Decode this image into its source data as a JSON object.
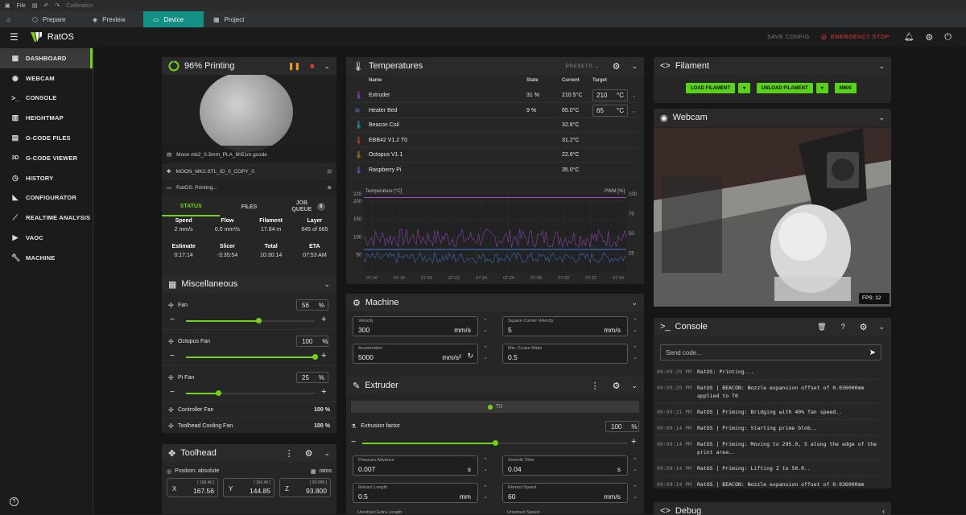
{
  "titlebar": {
    "file": "File",
    "title": "Calibration"
  },
  "tabs": [
    {
      "label": "Prepare",
      "icon": "prepare-icon"
    },
    {
      "label": "Preview",
      "icon": "preview-icon"
    },
    {
      "label": "Device",
      "icon": "device-icon"
    },
    {
      "label": "Project",
      "icon": "project-icon"
    }
  ],
  "app": {
    "name": "RatOS",
    "save_config": "SAVE CONFIG",
    "emergency_stop": "EMERGENCY STOP"
  },
  "sidebar": [
    {
      "label": "DASHBOARD",
      "icon": "dashboard-icon"
    },
    {
      "label": "WEBCAM",
      "icon": "webcam-icon"
    },
    {
      "label": "CONSOLE",
      "icon": "console-icon"
    },
    {
      "label": "HEIGHTMAP",
      "icon": "heightmap-icon"
    },
    {
      "label": "G-CODE FILES",
      "icon": "files-icon"
    },
    {
      "label": "G-CODE VIEWER",
      "icon": "viewer-icon"
    },
    {
      "label": "HISTORY",
      "icon": "history-icon"
    },
    {
      "label": "CONFIGURATOR",
      "icon": "configurator-icon"
    },
    {
      "label": "REALTIME ANALYSIS",
      "icon": "analysis-icon"
    },
    {
      "label": "VAOC",
      "icon": "vaoc-icon"
    },
    {
      "label": "MACHINE",
      "icon": "machine-icon"
    }
  ],
  "printing": {
    "title": "96% Printing",
    "progress": 0.96,
    "file": "Moon mk2_0.3mm_PLA_6h51m.gcode",
    "object": "MOON_MK2.STL_ID_0_COPY_0",
    "status_msg": "RatOS: Printing...",
    "tabs": [
      "STATUS",
      "FILES",
      "JOB QUEUE"
    ],
    "queue_count": "0",
    "stats1": [
      {
        "label": "Speed",
        "value": "2 mm/s"
      },
      {
        "label": "Flow",
        "value": "0.0 mm³/s"
      },
      {
        "label": "Filament",
        "value": "17.84 m"
      },
      {
        "label": "Layer",
        "value": "645 of 665"
      }
    ],
    "stats2": [
      {
        "label": "Estimate",
        "value": "0:17:14"
      },
      {
        "label": "Slicer",
        "value": "-3:35:54"
      },
      {
        "label": "Total",
        "value": "10:30:14"
      },
      {
        "label": "ETA",
        "value": "07:53 AM"
      }
    ]
  },
  "misc": {
    "title": "Miscellaneous",
    "fans": [
      {
        "label": "Fan",
        "value": "56",
        "unit": "%",
        "level": 0.56
      },
      {
        "label": "Octopus Fan",
        "value": "100",
        "unit": "%",
        "level": 1.0
      },
      {
        "label": "Pi Fan",
        "value": "25",
        "unit": "%",
        "level": 0.25
      }
    ],
    "static": [
      {
        "label": "Controller Fan",
        "value": "100 %"
      },
      {
        "label": "Toolhead Cooling Fan",
        "value": "100 %"
      }
    ]
  },
  "toolhead": {
    "title": "Toolhead",
    "position": "Position: absolute",
    "profile": "ratos",
    "axes": [
      {
        "axis": "X",
        "value": "167.56",
        "sub": "[ 168.46 ]"
      },
      {
        "axis": "Y",
        "value": "144.85",
        "sub": "[ 156.49 ]"
      },
      {
        "axis": "Z",
        "value": "93.800",
        "sub": "[ 93.998 ]"
      }
    ]
  },
  "temps": {
    "title": "Temperatures",
    "presets": "PRESETS",
    "headers": [
      "Name",
      "State",
      "Current",
      "Target"
    ],
    "rows": [
      {
        "name": "Extruder",
        "state": "31 %",
        "current": "210.5°C",
        "target": "210",
        "unit": "°C",
        "icon": "extruder-temp-icon",
        "color": "#9c4fc9"
      },
      {
        "name": "Heater Bed",
        "state": "9 %",
        "current": "65.0°C",
        "target": "65",
        "unit": "°C",
        "icon": "bed-icon",
        "color": "#4a7fd6"
      },
      {
        "name": "Beacon Coil",
        "state": "",
        "current": "32.8°C",
        "target": "",
        "unit": "",
        "icon": "thermometer-icon",
        "color": "#1eb7b7"
      },
      {
        "name": "EBB42 V1.2 T0",
        "state": "",
        "current": "31.2°C",
        "target": "",
        "unit": "",
        "icon": "thermometer-icon",
        "color": "#d94040"
      },
      {
        "name": "Octopus V1.1",
        "state": "",
        "current": "22.6°C",
        "target": "",
        "unit": "",
        "icon": "thermometer-icon",
        "color": "#c98a2a"
      },
      {
        "name": "Raspberry Pi",
        "state": "",
        "current": "35.0°C",
        "target": "",
        "unit": "",
        "icon": "thermometer-icon",
        "color": "#6b5fd9"
      }
    ]
  },
  "chart_data": {
    "type": "line",
    "ylabel": "Temperature [°C]",
    "y2label": "PWM [%]",
    "ylim": [
      0,
      220
    ],
    "y2lim": [
      0,
      100
    ],
    "yticks": [
      50,
      100,
      150,
      200,
      220
    ],
    "y2ticks": [
      25,
      50,
      75,
      100
    ],
    "xticks": [
      "07:16",
      "07:18",
      "07:20",
      "07:22",
      "07:24",
      "07:26",
      "07:28",
      "07:30",
      "07:32",
      "07:34"
    ],
    "series": [
      {
        "color": "#a04bd0",
        "target": 210
      },
      {
        "color": "#3c7ee0",
        "target": 65
      }
    ]
  },
  "machine": {
    "title": "Machine",
    "fields": [
      {
        "label": "Velocity",
        "value": "300",
        "unit": "mm/s"
      },
      {
        "label": "Square Corner Velocity",
        "value": "5",
        "unit": "mm/s"
      },
      {
        "label": "Acceleration",
        "value": "5000",
        "unit": "mm/s²"
      },
      {
        "label": "Min. Cruise Ratio",
        "value": "0.5",
        "unit": ""
      }
    ]
  },
  "extruder": {
    "title": "Extruder",
    "tool": "T0",
    "factor_label": "Extrusion factor",
    "factor_value": "100",
    "factor_unit": "%",
    "factor_level": 0.5,
    "fields": [
      {
        "label": "Pressure Advance",
        "value": "0.007",
        "unit": "s"
      },
      {
        "label": "Smooth Time",
        "value": "0.04",
        "unit": "s"
      },
      {
        "label": "Retract Length",
        "value": "0.5",
        "unit": "mm"
      },
      {
        "label": "Retract Speed",
        "value": "60",
        "unit": "mm/s"
      }
    ],
    "more": [
      "Unretract Extra Length",
      "Unretract Speed"
    ]
  },
  "filament": {
    "title": "Filament",
    "load": "LOAD FILAMENT",
    "unload": "UNLOAD FILAMENT",
    "m600": "M600"
  },
  "webcam": {
    "title": "Webcam",
    "fps": "FPS: 12"
  },
  "console": {
    "title": "Console",
    "placeholder": "Send code...",
    "lines": [
      {
        "time": "09:09:29 PM",
        "text": "RatOS: Printing..."
      },
      {
        "time": "09:09:29 PM",
        "text": "RatOS | BEACON: Nozzle expansion offset of 0.036000mm applied to T0"
      },
      {
        "time": "09:09:21 PM",
        "text": "RatOS | Priming: Bridging with 40% fan speed.."
      },
      {
        "time": "09:09:14 PM",
        "text": "RatOS | Priming: Starting prime blob.."
      },
      {
        "time": "09:09:14 PM",
        "text": "RatOS | Priming: Moving to 295.0, 5 along the edge of the print area.."
      },
      {
        "time": "09:09:14 PM",
        "text": "RatOS | Priming: Lifting Z to 50.0.."
      },
      {
        "time": "09:09:14 PM",
        "text": "RatOS | BEACON: Nozzle expansion offset of 0.036000mm"
      }
    ]
  },
  "debug": {
    "title": "Debug"
  }
}
